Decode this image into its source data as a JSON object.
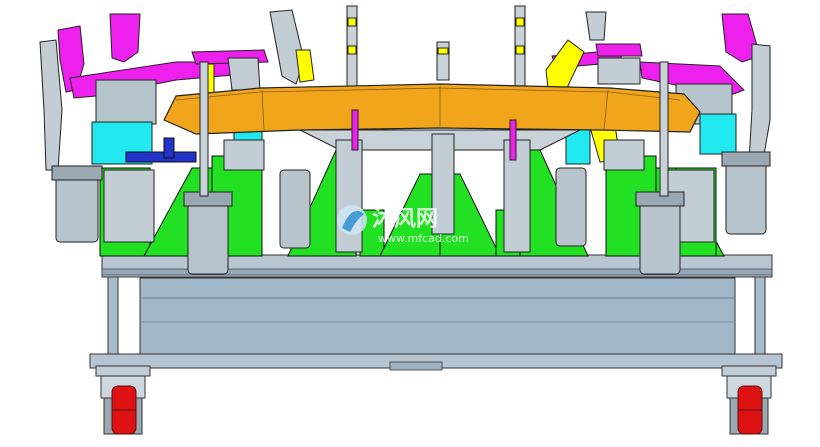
{
  "watermark": {
    "brand": "沐风网",
    "url": "www.mfcad.com"
  },
  "colors": {
    "background": "#ffffff",
    "green_support": "#22e022",
    "magenta_arm": "#ee20ee",
    "cyan_block": "#22e8f0",
    "yellow_part": "#ffff00",
    "orange_panel": "#f0a51a",
    "gray_steel": "#9aa6ae",
    "blue_frame": "#9fb3c3",
    "caster_red": "#dd1111"
  }
}
